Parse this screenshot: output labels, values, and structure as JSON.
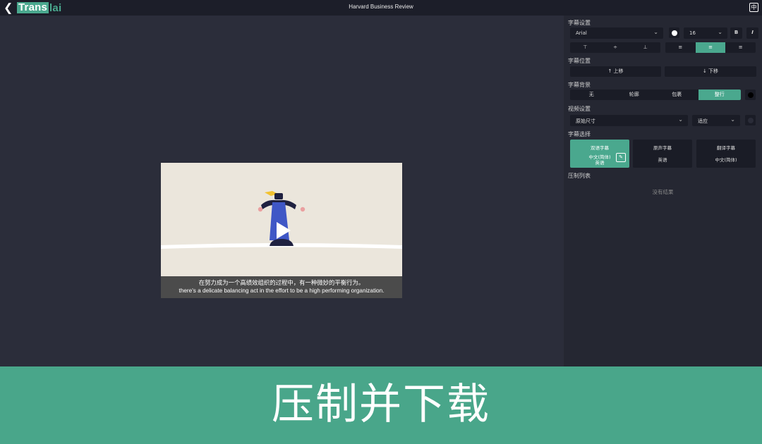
{
  "app": {
    "logo_part1": "Trans",
    "logo_part2": "lai",
    "window_title": "Harvard Business Review",
    "ime_label": "中"
  },
  "video": {
    "subtitle_zh": "在努力成为一个高绩效组织的过程中，有一种微妙的平衡行为。",
    "subtitle_en": "there's a delicate balancing act in the effort to be a high performing organization."
  },
  "panel": {
    "subtitle_settings": {
      "heading": "字幕设置",
      "font": "Arial",
      "font_color": "#ffffff",
      "size": "16",
      "bold": "B",
      "italic": "I",
      "valign": [
        "⊤",
        "⫲",
        "⊥"
      ],
      "halign_selected": 1
    },
    "subtitle_position": {
      "heading": "字幕位置",
      "up": "↑ 上移",
      "down": "↓ 下移"
    },
    "subtitle_background": {
      "heading": "字幕背景",
      "options": [
        "无",
        "轮廓",
        "包裹",
        "整行"
      ],
      "selected": 3,
      "color": "#000000"
    },
    "video_settings": {
      "heading": "视频设置",
      "size": "原始尺寸",
      "fit": "适应",
      "color": "#1a1c26"
    },
    "subtitle_choice": {
      "heading": "字幕选择",
      "cards": [
        {
          "title": "双语字幕",
          "line1": "中文(简体)",
          "line2": "英语"
        },
        {
          "title": "原声字幕",
          "line1": "英语",
          "line2": ""
        },
        {
          "title": "翻译字幕",
          "line1": "中文(简体)",
          "line2": ""
        }
      ],
      "selected": 0
    },
    "render_list": {
      "heading": "压制列表",
      "empty_text": "没有结果"
    }
  },
  "banner": {
    "text": "压制并下载"
  }
}
